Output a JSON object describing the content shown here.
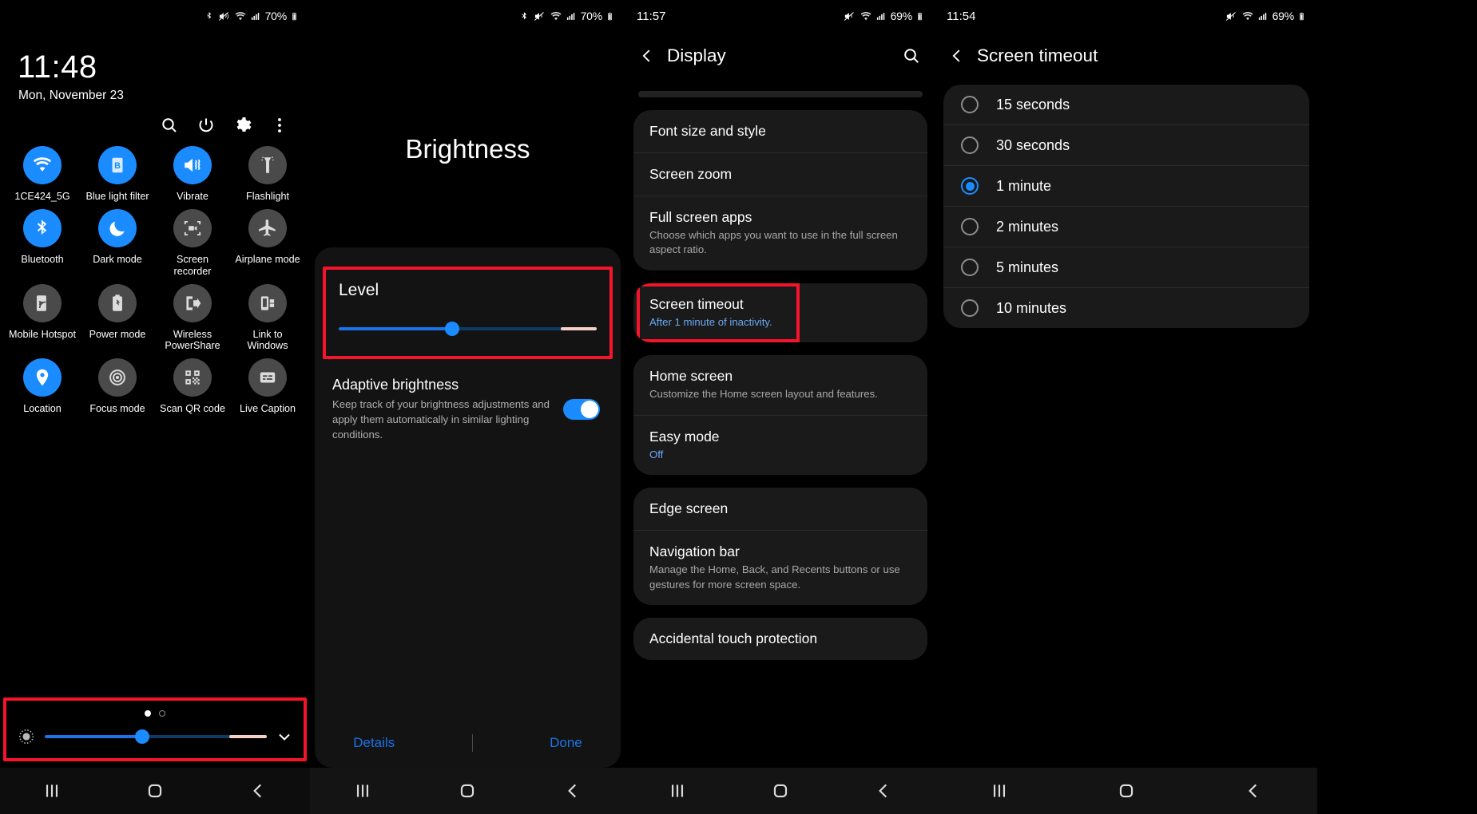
{
  "panel1": {
    "statusbar": {
      "time": "",
      "battery": "70%",
      "icons": [
        "bluetooth-icon",
        "mute-vibrate-icon",
        "wifi-icon",
        "signal-icon",
        "battery-icon"
      ]
    },
    "clock": "11:48",
    "date": "Mon, November 23",
    "actions": [
      "search-icon",
      "power-icon",
      "settings-gear-icon",
      "more-options-icon"
    ],
    "tiles": [
      {
        "label": "1CE424_5G",
        "icon": "wifi-icon",
        "state": "on"
      },
      {
        "label": "Blue light filter",
        "icon": "blue-light-filter-icon",
        "state": "on"
      },
      {
        "label": "Vibrate",
        "icon": "vibrate-icon",
        "state": "on"
      },
      {
        "label": "Flashlight",
        "icon": "flashlight-icon",
        "state": "off"
      },
      {
        "label": "Bluetooth",
        "icon": "bluetooth-icon",
        "state": "on"
      },
      {
        "label": "Dark mode",
        "icon": "moon-icon",
        "state": "on"
      },
      {
        "label": "Screen recorder",
        "icon": "screen-recorder-icon",
        "state": "off"
      },
      {
        "label": "Airplane mode",
        "icon": "airplane-icon",
        "state": "off"
      },
      {
        "label": "Mobile Hotspot",
        "icon": "hotspot-icon",
        "state": "off"
      },
      {
        "label": "Power mode",
        "icon": "power-mode-icon",
        "state": "off"
      },
      {
        "label": "Wireless PowerShare",
        "icon": "powershare-icon",
        "state": "off"
      },
      {
        "label": "Link to Windows",
        "icon": "link-to-windows-icon",
        "state": "off"
      },
      {
        "label": "Location",
        "icon": "location-pin-icon",
        "state": "on"
      },
      {
        "label": "Focus mode",
        "icon": "focus-mode-icon",
        "state": "off"
      },
      {
        "label": "Scan QR code",
        "icon": "qr-code-icon",
        "state": "off"
      },
      {
        "label": "Live Caption",
        "icon": "live-caption-icon",
        "state": "off"
      }
    ],
    "brightness": {
      "value_pct": 44,
      "tail_start_pct": 83,
      "icon": "brightness-icon",
      "expand_icon": "chevron-down-icon",
      "page_dots": 2,
      "active_dot": 0
    },
    "navbar": [
      "recents-icon",
      "home-icon",
      "back-icon"
    ]
  },
  "panel2": {
    "statusbar": {
      "time": "",
      "battery": "70%"
    },
    "title": "Brightness",
    "level_label": "Level",
    "level": {
      "value_pct": 44,
      "tail_start_pct": 86
    },
    "adaptive": {
      "title": "Adaptive brightness",
      "description": "Keep track of your brightness adjustments and apply them automatically in similar lighting conditions.",
      "enabled": true
    },
    "buttons": {
      "details": "Details",
      "done": "Done"
    },
    "navbar": [
      "recents-icon",
      "home-icon",
      "back-icon"
    ]
  },
  "panel3": {
    "statusbar": {
      "time": "11:57",
      "battery": "69%"
    },
    "title": "Display",
    "search_icon": "search-icon",
    "back_icon": "back-arrow-icon",
    "groups": [
      {
        "rows": [
          {
            "title": "Font size and style",
            "sub": ""
          },
          {
            "title": "Screen zoom",
            "sub": ""
          },
          {
            "title": "Full screen apps",
            "sub": "Choose which apps you want to use in the full screen aspect ratio."
          }
        ]
      },
      {
        "highlighted": true,
        "rows": [
          {
            "title": "Screen timeout",
            "sub": "After 1 minute of inactivity.",
            "sub_blue": true
          }
        ]
      },
      {
        "rows": [
          {
            "title": "Home screen",
            "sub": "Customize the Home screen layout and features."
          },
          {
            "title": "Easy mode",
            "sub": "Off",
            "sub_blue": true
          }
        ]
      },
      {
        "rows": [
          {
            "title": "Edge screen",
            "sub": ""
          },
          {
            "title": "Navigation bar",
            "sub": "Manage the Home, Back, and Recents buttons or use gestures for more screen space."
          }
        ]
      },
      {
        "rows": [
          {
            "title": "Accidental touch protection",
            "sub": ""
          }
        ]
      }
    ],
    "navbar": [
      "recents-icon",
      "home-icon",
      "back-icon"
    ]
  },
  "panel4": {
    "statusbar": {
      "time": "11:54",
      "battery": "69%"
    },
    "title": "Screen timeout",
    "back_icon": "back-arrow-icon",
    "options": [
      {
        "label": "15 seconds",
        "selected": false
      },
      {
        "label": "30 seconds",
        "selected": false
      },
      {
        "label": "1 minute",
        "selected": true
      },
      {
        "label": "2 minutes",
        "selected": false
      },
      {
        "label": "5 minutes",
        "selected": false
      },
      {
        "label": "10 minutes",
        "selected": false
      }
    ],
    "navbar": [
      "recents-icon",
      "home-icon",
      "back-icon"
    ]
  },
  "colors": {
    "accent": "#1a8cff",
    "link": "#1a73e8",
    "highlight": "#f5142a",
    "tile_off": "#4a4a4a",
    "card": "#1a1a1a"
  }
}
